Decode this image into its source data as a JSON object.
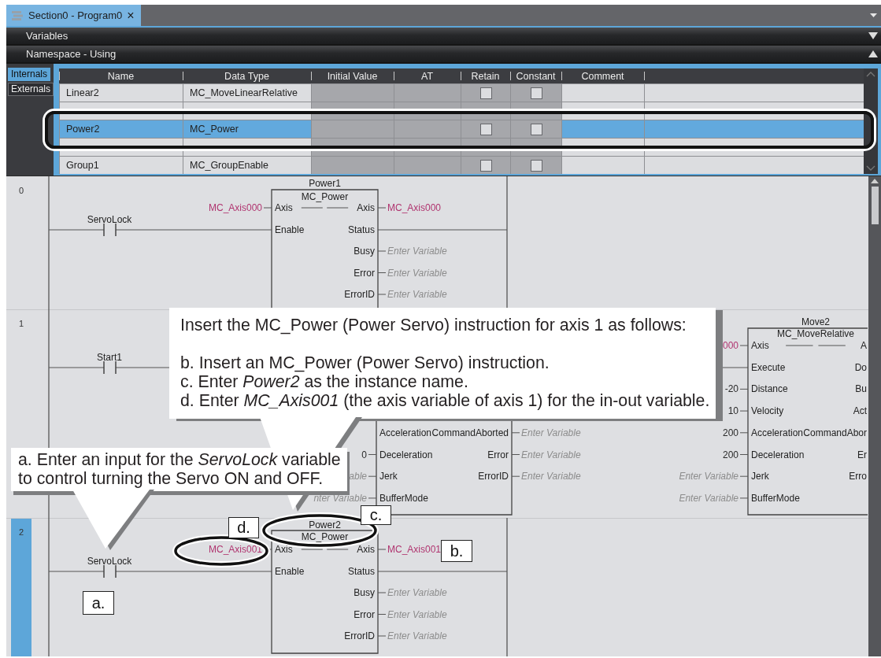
{
  "document_tab": {
    "title": "Section0 - Program0",
    "close": "×",
    "selected": true
  },
  "sections": [
    {
      "title": "Variables",
      "expanded": false
    },
    {
      "title": "Namespace - Using",
      "expanded": true
    }
  ],
  "variable_tabs": [
    {
      "label": "Internals",
      "selected": true
    },
    {
      "label": "Externals",
      "selected": false
    }
  ],
  "table": {
    "columns": [
      "Name",
      "Data Type",
      "Initial Value",
      "AT",
      "Retain",
      "Constant",
      "Comment"
    ],
    "rows": [
      {
        "kind": "full",
        "name": "Linear2",
        "data_type": "MC_MoveLinearRelative",
        "retain": false,
        "constant": false,
        "selected": false
      },
      {
        "kind": "partial"
      },
      {
        "kind": "full",
        "name": "Power2",
        "data_type": "MC_Power",
        "retain": false,
        "constant": false,
        "selected": true
      },
      {
        "kind": "partial"
      },
      {
        "kind": "full",
        "name": "Group1",
        "data_type": "MC_GroupEnable",
        "retain": false,
        "constant": false,
        "selected": false
      }
    ]
  },
  "rungs": [
    {
      "number": "0",
      "selected": false,
      "contacts": [
        {
          "label": "ServoLock"
        }
      ],
      "blocks": [
        {
          "instance": "Power1",
          "type": "MC_Power",
          "inputs": [
            {
              "pin": "Axis",
              "value": "MC_Axis000",
              "kind": "variable"
            },
            {
              "pin": "Enable"
            }
          ],
          "outputs": [
            {
              "pin": "Axis",
              "value": "MC_Axis000",
              "kind": "variable"
            },
            {
              "pin": "Status"
            },
            {
              "pin": "Busy",
              "placeholder": "Enter Variable"
            },
            {
              "pin": "Error",
              "placeholder": "Enter Variable"
            },
            {
              "pin": "ErrorID",
              "placeholder": "Enter Variable"
            }
          ]
        }
      ]
    },
    {
      "number": "1",
      "selected": false,
      "contacts": [
        {
          "label": "Start1"
        }
      ],
      "blocks": [
        {
          "inputs": [
            {
              "pin": "Acceleration"
            },
            {
              "pin": "Deceleration",
              "value": "0",
              "kind": "constant"
            },
            {
              "pin": "Jerk",
              "placeholder": "able"
            },
            {
              "pin": "BufferMode",
              "placeholder": "nter Variable"
            }
          ],
          "outputs": [
            {
              "pin": "CommandAborted",
              "placeholder": "Enter Variable"
            },
            {
              "pin": "Error",
              "placeholder": "Enter Variable"
            },
            {
              "pin": "ErrorID",
              "placeholder": "Enter Variable"
            }
          ]
        },
        {
          "instance": "Move2",
          "type": "MC_MoveRelative",
          "inputs": [
            {
              "pin": "Axis",
              "value": "000",
              "kind": "variable"
            },
            {
              "pin": "Execute"
            },
            {
              "pin": "Distance",
              "value": "-20",
              "kind": "constant"
            },
            {
              "pin": "Velocity",
              "value": "10",
              "kind": "constant"
            },
            {
              "pin": "Acceleration",
              "value": "200",
              "kind": "constant"
            },
            {
              "pin": "Deceleration",
              "value": "200",
              "kind": "constant"
            },
            {
              "pin": "Jerk",
              "placeholder": "Enter Variable"
            },
            {
              "pin": "BufferMode",
              "placeholder": "Enter Variable"
            }
          ],
          "outputs": [
            {
              "pin": "A"
            },
            {
              "pin": "Do"
            },
            {
              "pin": "Bu"
            },
            {
              "pin": "Act"
            },
            {
              "pin": "CommandAbor"
            },
            {
              "pin": "Er"
            },
            {
              "pin": "Erro"
            }
          ]
        }
      ]
    },
    {
      "number": "2",
      "selected": true,
      "contacts": [
        {
          "label": "ServoLock"
        }
      ],
      "blocks": [
        {
          "instance": "Power2",
          "type": "MC_Power",
          "inputs": [
            {
              "pin": "Axis",
              "value": "MC_Axis001",
              "kind": "variable"
            },
            {
              "pin": "Enable"
            }
          ],
          "outputs": [
            {
              "pin": "Axis",
              "value": "MC_Axis001",
              "kind": "variable"
            },
            {
              "pin": "Status"
            },
            {
              "pin": "Busy",
              "placeholder": "Enter Variable"
            },
            {
              "pin": "Error",
              "placeholder": "Enter Variable"
            },
            {
              "pin": "ErrorID",
              "placeholder": "Enter Variable"
            }
          ]
        }
      ]
    }
  ],
  "callouts": [
    {
      "lines": [
        "Insert the MC_Power (Power Servo) instruction for axis 1 as follows:",
        "b. Insert an MC_Power (Power Servo) instruction.",
        "c. Enter *Power2* as the instance name.",
        "d. Enter *MC_Axis001* (the axis variable of axis 1) for the in-out variable."
      ]
    },
    {
      "lines": [
        "a. Enter an input for the *ServoLock* variable to control turning the Servo ON and OFF."
      ]
    }
  ],
  "markers": [
    "c.",
    "d.",
    "b.",
    "a."
  ]
}
